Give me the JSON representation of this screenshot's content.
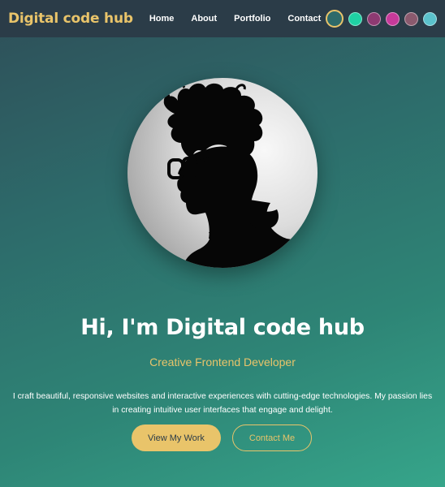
{
  "navbar": {
    "logo": "Digital code hub",
    "links": [
      "Home",
      "About",
      "Portfolio",
      "Contact"
    ],
    "theme_swatches": [
      {
        "name": "teal-dark",
        "color": "#2d6a6a",
        "active": true
      },
      {
        "name": "emerald",
        "color": "#1fd1a4",
        "active": false
      },
      {
        "name": "plum",
        "color": "#8e3a72",
        "active": false
      },
      {
        "name": "magenta",
        "color": "#c63a9a",
        "active": false
      },
      {
        "name": "rose-slate",
        "color": "#8a5a6e",
        "active": false
      },
      {
        "name": "aqua",
        "color": "#5bc2cc",
        "active": false
      }
    ]
  },
  "hero": {
    "avatar_icon": "silhouette-portrait",
    "title": "Hi, I'm Digital code hub",
    "subtitle": "Creative Frontend Developer",
    "description": "I craft beautiful, responsive websites and interactive experiences with cutting-edge technologies. My passion lies in creating intuitive user interfaces that engage and delight.",
    "primary_button": "View My Work",
    "secondary_button": "Contact Me"
  },
  "colors": {
    "accent": "#e9c46a",
    "navbar_bg": "#2b3c48",
    "text": "#ffffff"
  }
}
